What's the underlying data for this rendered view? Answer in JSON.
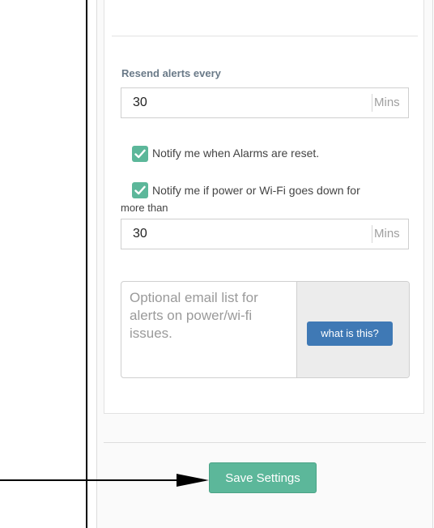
{
  "resend": {
    "label": "Resend alerts every",
    "value": "30",
    "unit": "Mins"
  },
  "notify_reset": {
    "label": "Notify me when Alarms are reset.",
    "checked": true
  },
  "notify_power": {
    "label_line1": "Notify me if power or Wi-Fi goes down for",
    "label_line2": "more than",
    "checked": true,
    "value": "30",
    "unit": "Mins"
  },
  "email_list": {
    "placeholder": "Optional email list for alerts on power/wi-fi issues.",
    "help_button": "what is this?"
  },
  "save_button": "Save Settings",
  "colors": {
    "accent_green": "#5cb79a",
    "help_blue": "#3f79b5"
  }
}
